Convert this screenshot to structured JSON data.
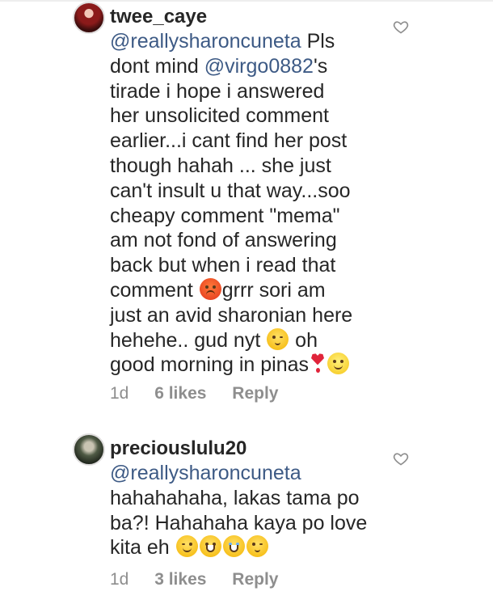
{
  "comments": [
    {
      "username": "twee_caye",
      "mention": "@reallysharoncuneta",
      "line1_rest": " Pls",
      "lines": [
        "dont mind ",
        "'s",
        "tirade i hope i answered",
        "her unsolicited comment",
        "earlier...i cant find her post",
        "though hahah ... she just",
        "can't insult u that way...soo",
        "cheapy comment \"mema\"",
        "am not fond of answering",
        "back  but when i read that",
        "comment ",
        "grrr sori am",
        "just an avid sharonian here",
        "hehehe.. gud nyt ",
        " oh",
        "good morning in pinas"
      ],
      "mention2": "@virgo0882",
      "time": "1d",
      "likes": "6 likes",
      "reply": "Reply",
      "emojis": [
        "angry-face-icon",
        "kissing-face-icon",
        "heart-exclamation-icon",
        "smiling-face-icon"
      ]
    },
    {
      "username": "preciouslulu20",
      "mention": "@reallysharoncuneta",
      "lines": [
        "hahahahaha, lakas tama po",
        "ba?! Hahahaha kaya po love",
        "kita eh "
      ],
      "time": "1d",
      "likes": "3 likes",
      "reply": "Reply",
      "emojis": [
        "winking-face-icon",
        "grinning-sweat-face-icon",
        "joy-face-icon",
        "kissing-face-icon"
      ]
    }
  ],
  "colors": {
    "mention": "#3d5a85",
    "text": "#262626",
    "meta": "#8e8e8e"
  }
}
